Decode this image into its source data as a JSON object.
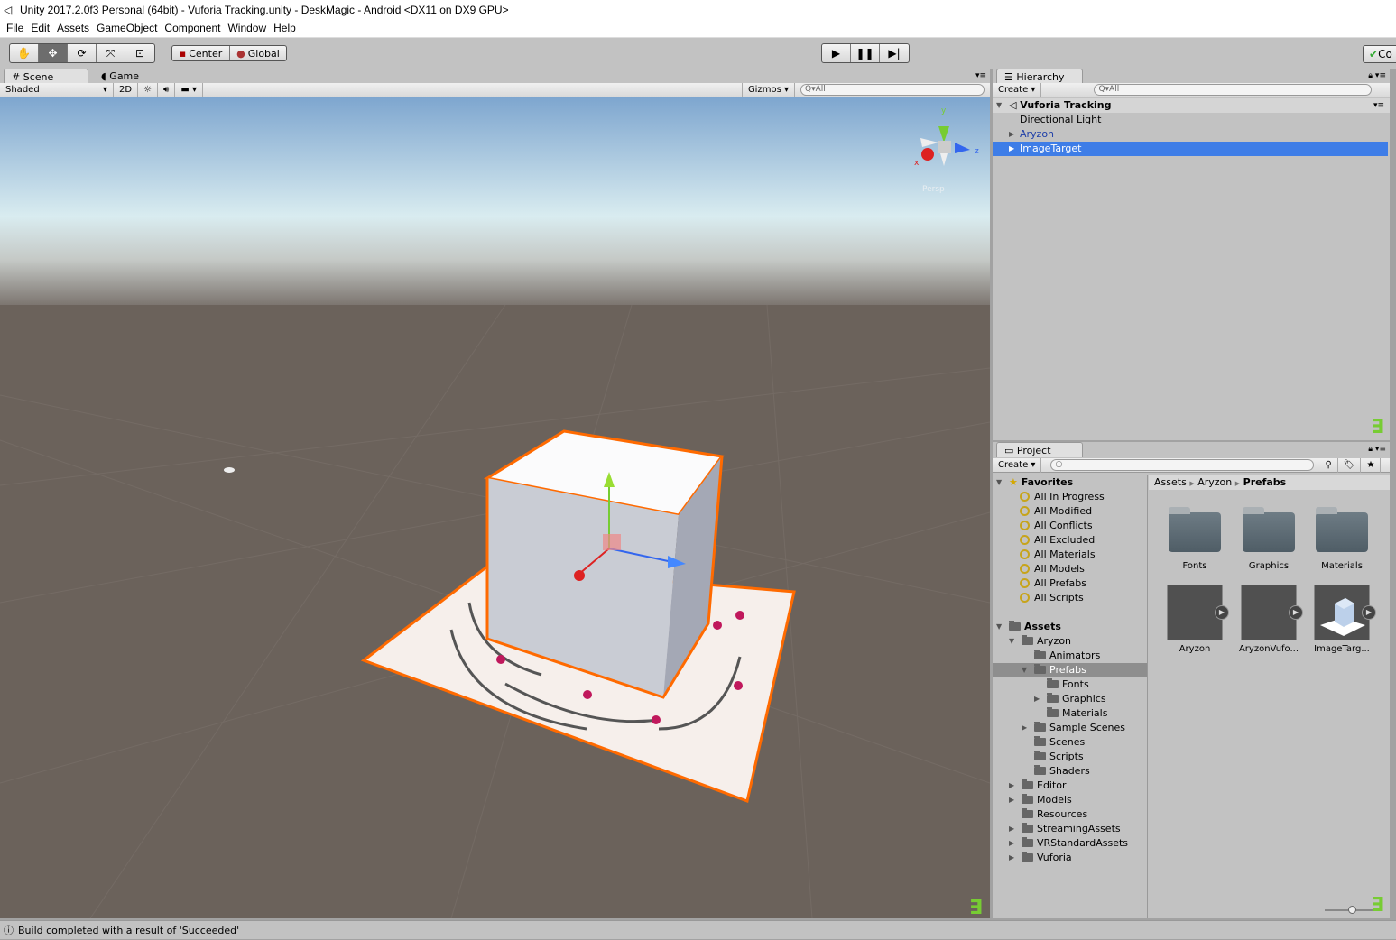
{
  "window": {
    "title": "Unity 2017.2.0f3 Personal (64bit) - Vuforia Tracking.unity - DeskMagic - Android <DX11 on DX9 GPU>"
  },
  "menu": [
    "File",
    "Edit",
    "Assets",
    "GameObject",
    "Component",
    "Window",
    "Help"
  ],
  "toolbar": {
    "tools": [
      "hand-icon",
      "move-icon",
      "rotate-icon",
      "scale-icon",
      "rect-icon"
    ],
    "active_tool": "move",
    "pivot": "Center",
    "space": "Global",
    "play": "play-icon",
    "pause": "pause-icon",
    "step": "step-icon",
    "collab": "Co"
  },
  "scene": {
    "tab_scene": "Scene",
    "tab_game": "Game",
    "shading": "Shaded",
    "mode_2d": "2D",
    "gizmos": "Gizmos",
    "search": "All",
    "axis_x": "x",
    "axis_y": "y",
    "axis_z": "z",
    "persp": "Persp"
  },
  "hierarchy": {
    "tab": "Hierarchy",
    "create": "Create",
    "search": "All",
    "scene": "Vuforia Tracking",
    "items": [
      {
        "label": "Directional Light",
        "color": "#000000"
      },
      {
        "label": "Aryzon",
        "color": "#1e3ea8"
      },
      {
        "label": "ImageTarget",
        "color": "#ffffff",
        "selected": true
      }
    ]
  },
  "project": {
    "tab": "Project",
    "create": "Create",
    "favorites_label": "Favorites",
    "favorites": [
      "All In Progress",
      "All Modified",
      "All Conflicts",
      "All Excluded",
      "All Materials",
      "All Models",
      "All Prefabs",
      "All Scripts"
    ],
    "assets_label": "Assets",
    "tree": [
      {
        "label": "Aryzon",
        "depth": 1,
        "arrow": "open"
      },
      {
        "label": "Animators",
        "depth": 2
      },
      {
        "label": "Prefabs",
        "depth": 2,
        "arrow": "open",
        "selected": true
      },
      {
        "label": "Fonts",
        "depth": 3
      },
      {
        "label": "Graphics",
        "depth": 3,
        "arrow": "closed"
      },
      {
        "label": "Materials",
        "depth": 3
      },
      {
        "label": "Sample Scenes",
        "depth": 2,
        "arrow": "closed"
      },
      {
        "label": "Scenes",
        "depth": 2
      },
      {
        "label": "Scripts",
        "depth": 2
      },
      {
        "label": "Shaders",
        "depth": 2
      },
      {
        "label": "Editor",
        "depth": 1,
        "arrow": "closed"
      },
      {
        "label": "Models",
        "depth": 1,
        "arrow": "closed"
      },
      {
        "label": "Resources",
        "depth": 1
      },
      {
        "label": "StreamingAssets",
        "depth": 1,
        "arrow": "closed"
      },
      {
        "label": "VRStandardAssets",
        "depth": 1,
        "arrow": "closed"
      },
      {
        "label": "Vuforia",
        "depth": 1,
        "arrow": "closed"
      }
    ],
    "breadcrumb": [
      "Assets",
      "Aryzon",
      "Prefabs"
    ],
    "folders": [
      "Fonts",
      "Graphics",
      "Materials"
    ],
    "prefabs": [
      "Aryzon",
      "AryzonVufo...",
      "ImageTarg..."
    ]
  },
  "status": {
    "message": "Build completed with a result of 'Succeeded'"
  },
  "colors": {
    "selection": "#3e7de7",
    "selection_bar": "#ff6a00"
  }
}
